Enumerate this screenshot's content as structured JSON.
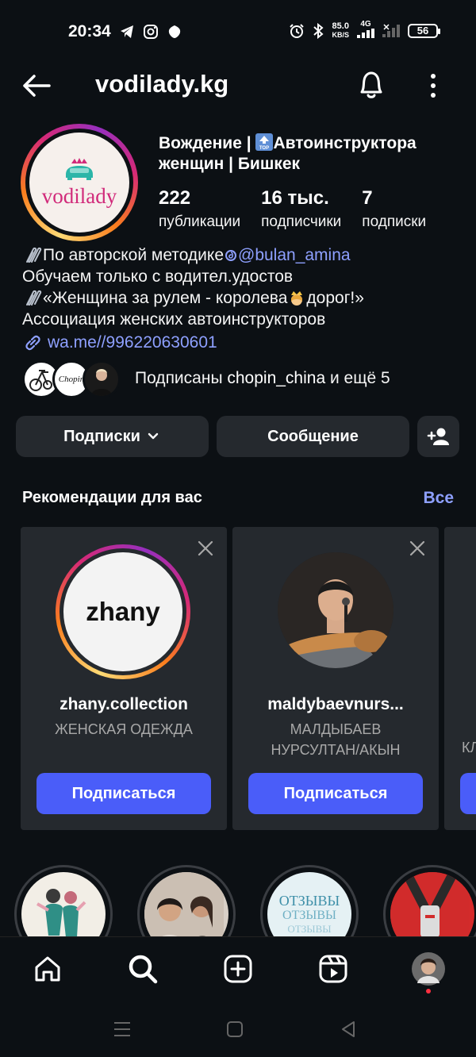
{
  "status_bar": {
    "time": "20:34",
    "net_speed_value": "85.0",
    "net_speed_unit": "KB/S",
    "network": "4G",
    "battery": "56"
  },
  "header": {
    "username": "vodilady.kg"
  },
  "profile": {
    "avatar_logo_text": "vodilady",
    "name_part1": "Вождение | ",
    "name_badge": "TOP",
    "name_part2": "Автоинструктора женщин | Бишкек",
    "stats": {
      "posts_value": "222",
      "posts_label": "публикации",
      "followers_value": "16 тыс.",
      "followers_label": "подписчики",
      "following_value": "7",
      "following_label": "подписки"
    },
    "bio": {
      "line1_text": "По авторской методике ",
      "line1_mention": "@bulan_amina",
      "line2": "Обучаем только с водител.удостов",
      "line3_a": "«Женщина за рулем - королева ",
      "line3_b": " дорог!»",
      "line4": "Ассоциация женских автоинструкторов",
      "link": "wa.me//996220630601"
    },
    "followed_by_prefix": "Подписаны ",
    "followed_by_user": "chopin_china",
    "followed_by_suffix": " и ещё 5",
    "mini_avatar_2_text": "Chopin"
  },
  "actions": {
    "following_label": "Подписки",
    "message_label": "Сообщение"
  },
  "suggestions": {
    "title": "Рекомендации для вас",
    "see_all": "Все",
    "cards": [
      {
        "pic_text": "zhany",
        "name": "zhany.collection",
        "subtitle": "ЖЕНСКАЯ ОДЕЖДА",
        "button": "Подписаться"
      },
      {
        "name": "maldybaevnurs...",
        "subtitle": "МАЛДЫБАЕВ НУРСУЛТАН/АКЫН",
        "button": "Подписаться"
      }
    ],
    "partial_card_subtitle": "КЛ"
  },
  "highlights": {
    "otzyvy_line1": "ОТЗЫВЫ",
    "otzyvy_line2": "ОТЗЫВЫ",
    "otzyvy_line3": "ОТЗЫВЫ"
  },
  "colors": {
    "background": "#0c1014",
    "card": "#25292e",
    "accent_blue": "#4a5df9",
    "link": "#8ea0ff"
  }
}
